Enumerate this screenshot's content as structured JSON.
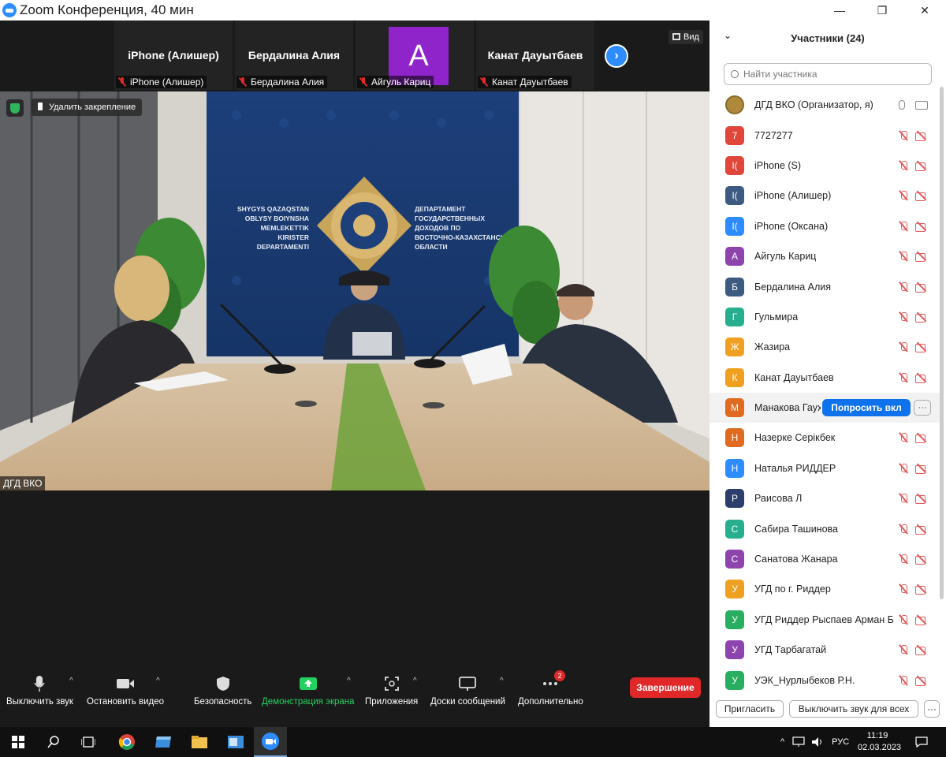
{
  "window": {
    "title": "Zoom Конференция, 40 мин"
  },
  "filmstrip": [
    {
      "name": "iPhone (Алишер)",
      "tag": "iPhone (Алишер)"
    },
    {
      "name": "Бердалина Алия",
      "tag": "Бердалина Алия"
    },
    {
      "avatar_letter": "А",
      "avatar_color": "#8e24c9",
      "tag": "Айгуль Кариц"
    },
    {
      "name": "Канат Дауытбаев",
      "tag": "Канат Дауытбаев"
    }
  ],
  "view_button": "Вид",
  "main_video": {
    "unpin_label": "Удалить закрепление",
    "speaker": "ДГД ВКО",
    "wall_text_left": [
      "SHYGYS QAZAQSTAN",
      "OBLYSY BOIYNSHA",
      "MEMLEKETTIK",
      "KIRISTER",
      "DEPARTAMENTI"
    ],
    "wall_text_right": [
      "ДЕПАРТАМЕНТ",
      "ГОСУДАРСТВЕННЫХ",
      "ДОХОДОВ ПО",
      "ВОСТОЧНО-КАЗАХСТАНСКОЙ",
      "ОБЛАСТИ"
    ]
  },
  "toolbar": {
    "mute": "Выключить звук",
    "stop_video": "Остановить видео",
    "security": "Безопасность",
    "share": "Демонстрация экрана",
    "apps": "Приложения",
    "whiteboards": "Доски сообщений",
    "more": "Дополнительно",
    "more_badge": "2",
    "end": "Завершение"
  },
  "participants": {
    "header": "Участники (24)",
    "search_placeholder": "Найти участника",
    "list": [
      {
        "initial": "",
        "name": "ДГД ВКО (Организатор, я)",
        "color": "#b08a3c",
        "mic": "on",
        "cam": "on"
      },
      {
        "initial": "7",
        "name": "7727277",
        "color": "#e0463a",
        "mic": "off",
        "cam": "off"
      },
      {
        "initial": "I(",
        "name": "iPhone (S)",
        "color": "#e0463a",
        "mic": "off",
        "cam": "off"
      },
      {
        "initial": "I(",
        "name": "iPhone (Алишер)",
        "color": "#3d5a80",
        "mic": "off",
        "cam": "off"
      },
      {
        "initial": "I(",
        "name": "iPhone (Оксана)",
        "color": "#2d8cff",
        "mic": "off",
        "cam": "off"
      },
      {
        "initial": "А",
        "name": "Айгуль Кариц",
        "color": "#8e44ad",
        "mic": "off",
        "cam": "off"
      },
      {
        "initial": "Б",
        "name": "Бердалина Алия",
        "color": "#3d5a80",
        "mic": "off",
        "cam": "off"
      },
      {
        "initial": "Г",
        "name": "Гульмира",
        "color": "#27ae8f",
        "mic": "off",
        "cam": "off"
      },
      {
        "initial": "Ж",
        "name": "Жазира",
        "color": "#f0a020",
        "mic": "off",
        "cam": "off"
      },
      {
        "initial": "К",
        "name": "Канат Дауытбаев",
        "color": "#f0a020",
        "mic": "off",
        "cam": "off"
      },
      {
        "initial": "М",
        "name": "Манакова Гаухар",
        "color": "#e06a20",
        "mic": "off",
        "cam": "off",
        "ask_label": "Попросить вкл",
        "more_label": "···"
      },
      {
        "initial": "Н",
        "name": "Назерке Серікбек",
        "color": "#e06a20",
        "mic": "off",
        "cam": "off"
      },
      {
        "initial": "Н",
        "name": "Наталья РИДДЕР",
        "color": "#2d8cff",
        "mic": "off",
        "cam": "off"
      },
      {
        "initial": "Р",
        "name": "Раисова Л",
        "color": "#2c3e6b",
        "mic": "off",
        "cam": "off"
      },
      {
        "initial": "С",
        "name": "Сабира Ташинова",
        "color": "#27ae8f",
        "mic": "off",
        "cam": "off"
      },
      {
        "initial": "С",
        "name": "Санатова Жанара",
        "color": "#8e44ad",
        "mic": "off",
        "cam": "off"
      },
      {
        "initial": "У",
        "name": "УГД по г. Риддер",
        "color": "#f0a020",
        "mic": "off",
        "cam": "off"
      },
      {
        "initial": "У",
        "name": "УГД Риддер Рыспаев Арман Б...",
        "color": "#27ae60",
        "mic": "off",
        "cam": "off"
      },
      {
        "initial": "У",
        "name": "УГД Тарбагатай",
        "color": "#8e44ad",
        "mic": "off",
        "cam": "off"
      },
      {
        "initial": "У",
        "name": "УЭК_Нурлыбеков Р.Н.",
        "color": "#27ae60",
        "mic": "off",
        "cam": "off"
      }
    ],
    "invite": "Пригласить",
    "mute_all": "Выключить звук для всех",
    "more": "···"
  },
  "taskbar": {
    "lang": "РУС",
    "time": "11:19",
    "date": "02.03.2023"
  }
}
